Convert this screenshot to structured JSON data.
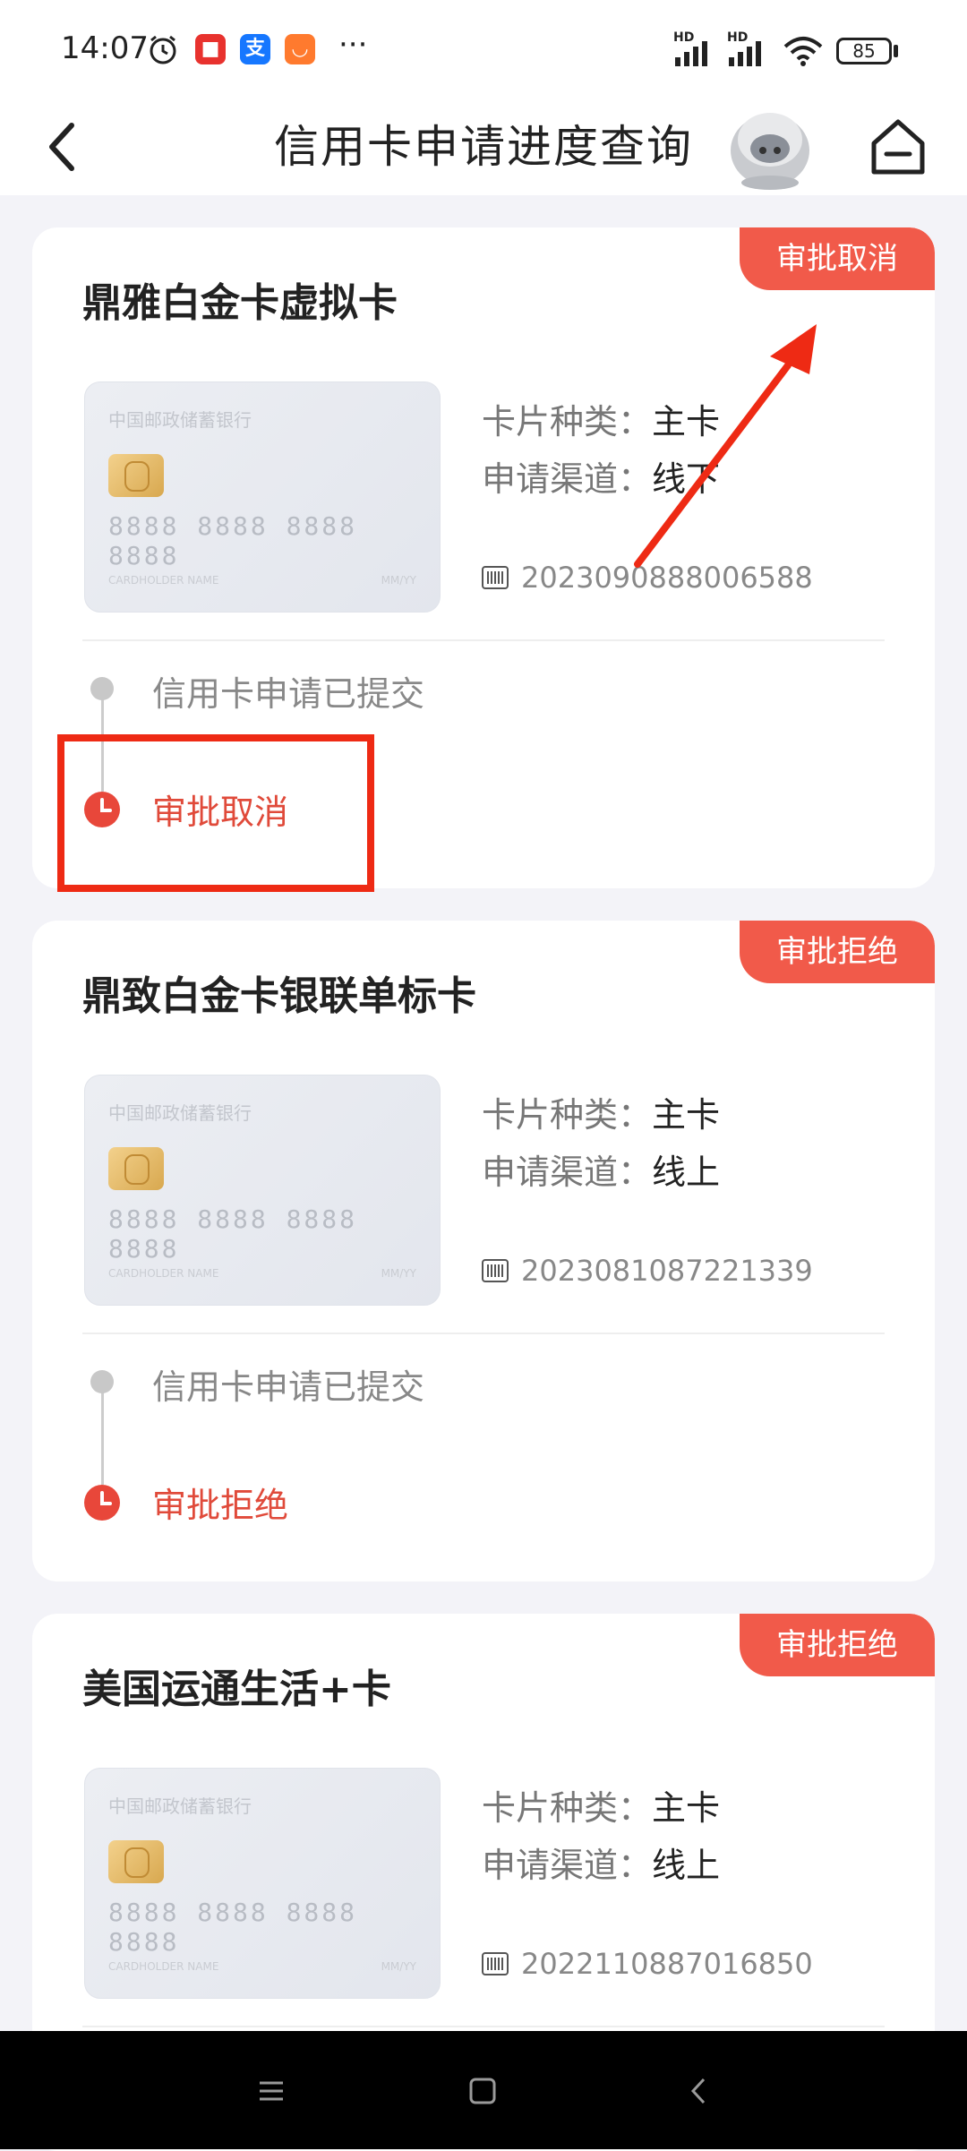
{
  "status_bar": {
    "time": "14:07",
    "network_1": "HD",
    "network_2": "HD",
    "battery": "85",
    "more": "···",
    "app_icons": [
      "alarm-icon",
      "red-packet-app-icon",
      "alipay-app-icon",
      "taobao-app-icon"
    ]
  },
  "header": {
    "title": "信用卡申请进度查询"
  },
  "cards": [
    {
      "status_tag": "审批取消",
      "name": "鼎雅白金卡虚拟卡",
      "card_image": {
        "bank": "中国邮政储蓄银行",
        "number": "8888 8888 8888 8888",
        "holder": "CARDHOLDER NAME",
        "valid": "MM/YY"
      },
      "type_label": "卡片种类：",
      "type_value": "主卡",
      "channel_label": "申请渠道：",
      "channel_value": "线下",
      "application_no": "2023090888006588",
      "steps": [
        "信用卡申请已提交",
        "审批取消"
      ]
    },
    {
      "status_tag": "审批拒绝",
      "name": "鼎致白金卡银联单标卡",
      "card_image": {
        "bank": "中国邮政储蓄银行",
        "number": "8888 8888 8888 8888",
        "holder": "CARDHOLDER NAME",
        "valid": "MM/YY"
      },
      "type_label": "卡片种类：",
      "type_value": "主卡",
      "channel_label": "申请渠道：",
      "channel_value": "线上",
      "application_no": "2023081087221339",
      "steps": [
        "信用卡申请已提交",
        "审批拒绝"
      ]
    },
    {
      "status_tag": "审批拒绝",
      "name": "美国运通生活+卡",
      "card_image": {
        "bank": "中国邮政储蓄银行",
        "number": "8888 8888 8888 8888",
        "holder": "CARDHOLDER NAME",
        "valid": "MM/YY"
      },
      "type_label": "卡片种类：",
      "type_value": "主卡",
      "channel_label": "申请渠道：",
      "channel_value": "线上",
      "application_no": "2022110887016850",
      "steps": []
    }
  ],
  "colors": {
    "accent": "#f15a4a",
    "annotation": "#ee2a14",
    "background": "#f3f3f8"
  }
}
